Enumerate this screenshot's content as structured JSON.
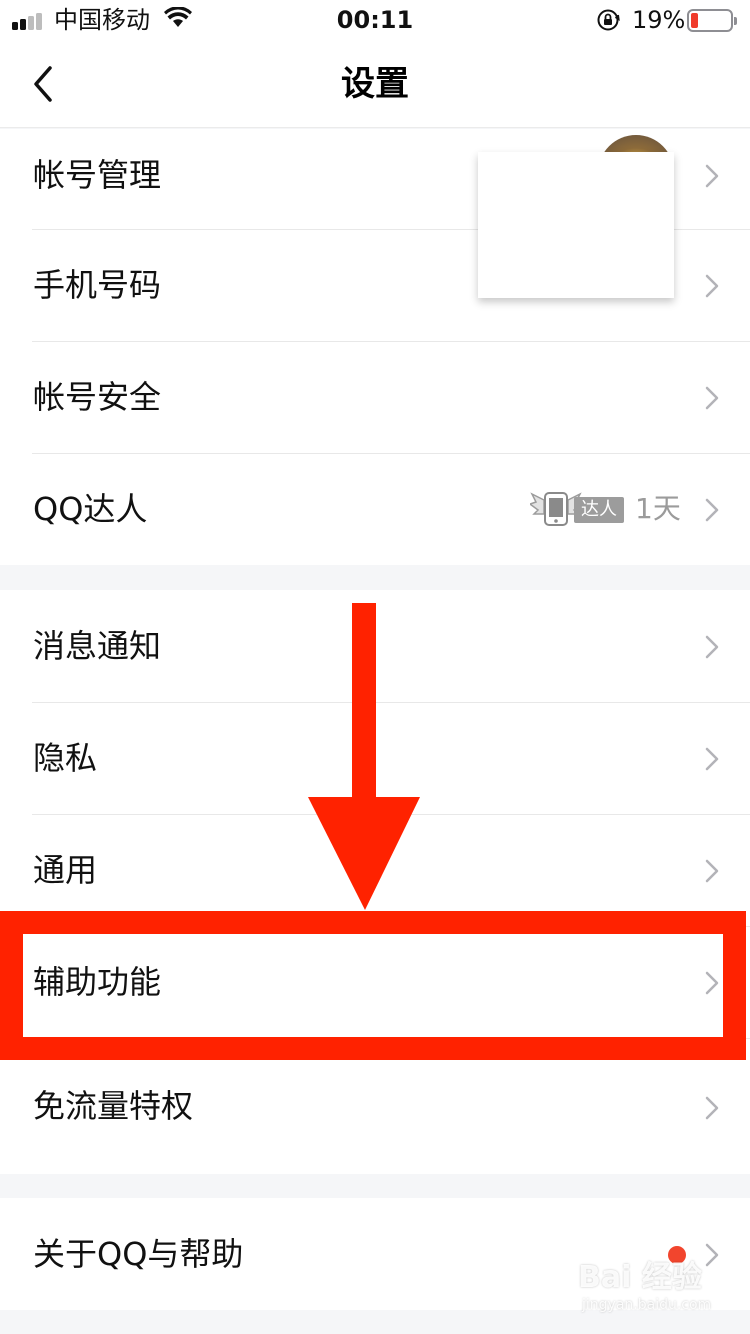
{
  "status_bar": {
    "carrier": "中国移动",
    "time": "00:11",
    "battery_percent": "19%",
    "battery_level": 0.19,
    "colors": {
      "battery_low": "#f03b2b"
    }
  },
  "nav": {
    "title": "设置",
    "back_icon": "chevron-left-icon"
  },
  "groups": [
    {
      "items": [
        {
          "label": "帐号管理",
          "accessory": "avatar"
        },
        {
          "label": "手机号码"
        },
        {
          "label": "帐号安全"
        },
        {
          "label": "QQ达人",
          "badge_text": "达人",
          "detail": "1天"
        }
      ]
    },
    {
      "items": [
        {
          "label": "消息通知"
        },
        {
          "label": "隐私"
        },
        {
          "label": "通用"
        },
        {
          "label": "辅助功能",
          "highlighted": true
        },
        {
          "label": "免流量特权"
        }
      ]
    },
    {
      "items": [
        {
          "label": "关于QQ与帮助",
          "has_red_dot": true
        }
      ]
    }
  ],
  "annotation": {
    "arrow_color": "#ff2200",
    "box_color": "#ff2200"
  },
  "watermark": {
    "logo": "Bai 经验",
    "url": "jingyan.baidu.com"
  }
}
